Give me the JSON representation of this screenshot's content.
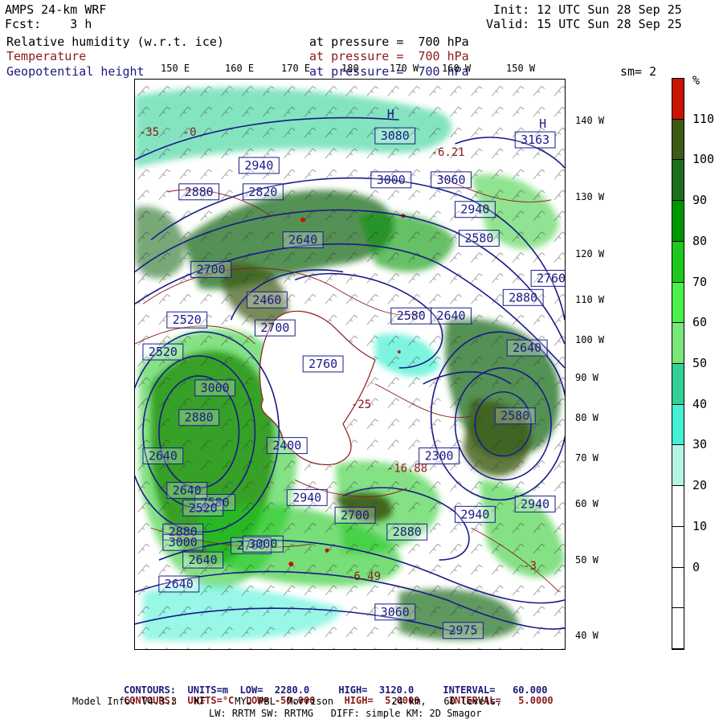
{
  "header": {
    "model": "AMPS 24-km WRF",
    "fcst": "Fcst:    3 h",
    "init": "Init: 12 UTC Sun 28 Sep 25",
    "valid": "Valid: 15 UTC Sun 28 Sep 25",
    "field1_name": "Relative humidity (w.r.t. ice)",
    "field1_level": "at pressure =  700 hPa",
    "field2_name": "Temperature",
    "field2_level": "at pressure =  700 hPa",
    "field3_name": "Geopotential height",
    "field3_level": "at pressure =  700 hPa",
    "smoothing": "sm= 2"
  },
  "top_ticks": [
    "150 E",
    "160 E",
    "170 E",
    "180",
    "170 W",
    "160 W",
    "150 W"
  ],
  "right_ticks": [
    "140 W",
    "130 W",
    "120 W",
    "110 W",
    "100 W",
    "90 W",
    "80 W",
    "70 W",
    "60 W",
    "50 W",
    "40 W"
  ],
  "legend": {
    "unit": "%",
    "labels": [
      "110",
      "100",
      "90",
      "80",
      "70",
      "60",
      "50",
      "40",
      "30",
      "20",
      "10",
      "0"
    ],
    "colors": [
      "#c81400",
      "#3c5a14",
      "#1e6e1e",
      "#009600",
      "#1ec81e",
      "#4bf04b",
      "#78e678",
      "#32d296",
      "#46f0d2",
      "#b4f5e6",
      "#ffffff",
      "#ffffff",
      "#ffffff",
      "#ffffff"
    ]
  },
  "map_labels": {
    "height_labels": [
      "3080",
      "3163",
      "3000",
      "3060",
      "2940",
      "2880",
      "2940",
      "2820",
      "2580",
      "2640",
      "2700",
      "2460",
      "2520",
      "2580",
      "2640",
      "2880",
      "2760",
      "2640",
      "2580",
      "2520",
      "2700",
      "2760",
      "2940",
      "3000",
      "2880",
      "2640",
      "2580",
      "2400",
      "2300",
      "2520",
      "2640",
      "2760",
      "2880",
      "3000",
      "2700",
      "2880",
      "2940",
      "3060",
      "2975",
      "2940",
      "2640",
      "3000",
      "2640"
    ],
    "high_marker": "H",
    "temp_labels": [
      "-35",
      "-0",
      "-6.21",
      "-6.49",
      "-3",
      "-16.88",
      "-25"
    ]
  },
  "footer": {
    "line1_label": "CONTOURS:",
    "line1_units": "UNITS=m",
    "line1_low": "LOW=  2280.0",
    "line1_high": "HIGH=  3120.0",
    "line1_interval": "INTERVAL=   60.000",
    "line2_label": "CONTOURS:",
    "line2_units": "UNITS=°C",
    "line2_low": "LOW= -50.000",
    "line2_high": "HIGH=  5.0000",
    "line2_interval": "INTERVAL=   5.0000",
    "line3": "Model Info: V4.3.3   KF     MYJ PBL  Morrison          24 km,   60 levels,",
    "line4": "LW: RRTM SW: RRTMG   DIFF: simple KM: 2D Smagor"
  }
}
